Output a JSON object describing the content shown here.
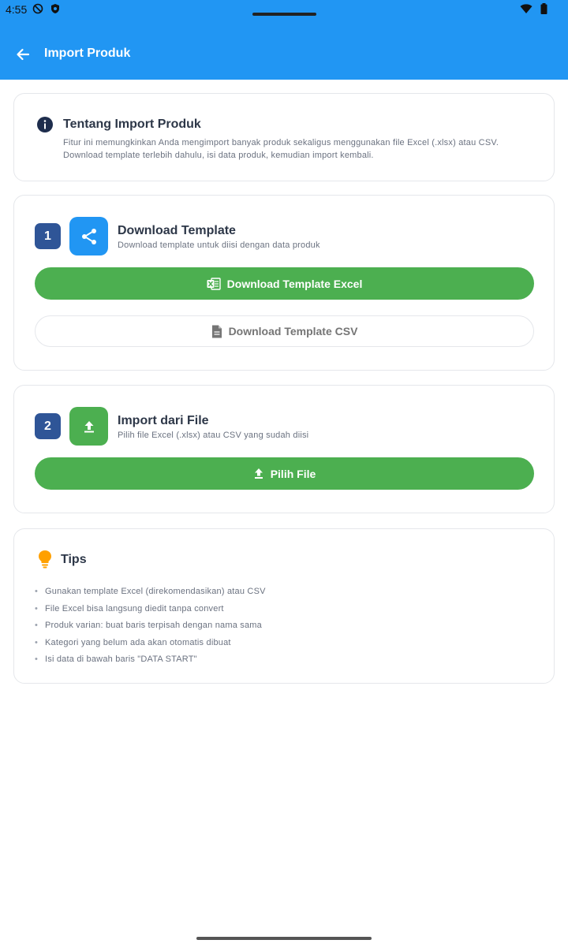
{
  "status_bar": {
    "time": "4:55"
  },
  "appbar": {
    "title": "Import Produk"
  },
  "about": {
    "title": "Tentang Import Produk",
    "description": "Fitur ini memungkinkan Anda mengimport banyak produk sekaligus menggunakan file Excel (.xlsx) atau CSV. Download template terlebih dahulu, isi data produk, kemudian import kembali."
  },
  "download": {
    "step": "1",
    "title": "Download Template",
    "subtitle": "Download template untuk diisi dengan data produk",
    "excel_button": "Download Template Excel",
    "csv_button": "Download Template CSV"
  },
  "import": {
    "step": "2",
    "title": "Import dari File",
    "subtitle": "Pilih file Excel (.xlsx) atau CSV yang sudah diisi",
    "choose_button": "Pilih File"
  },
  "tips": {
    "title": "Tips",
    "items": [
      "Gunakan template Excel (direkomendasikan) atau CSV",
      "File Excel bisa langsung diedit tanpa convert",
      "Produk varian: buat baris terpisah dengan nama sama",
      "Kategori yang belum ada akan otomatis dibuat",
      "Isi data di bawah baris \"DATA START\""
    ]
  },
  "colors": {
    "primary": "#2196F3",
    "success": "#4CAF50",
    "badge": "#2f5597",
    "tips_icon": "#FFA000"
  }
}
